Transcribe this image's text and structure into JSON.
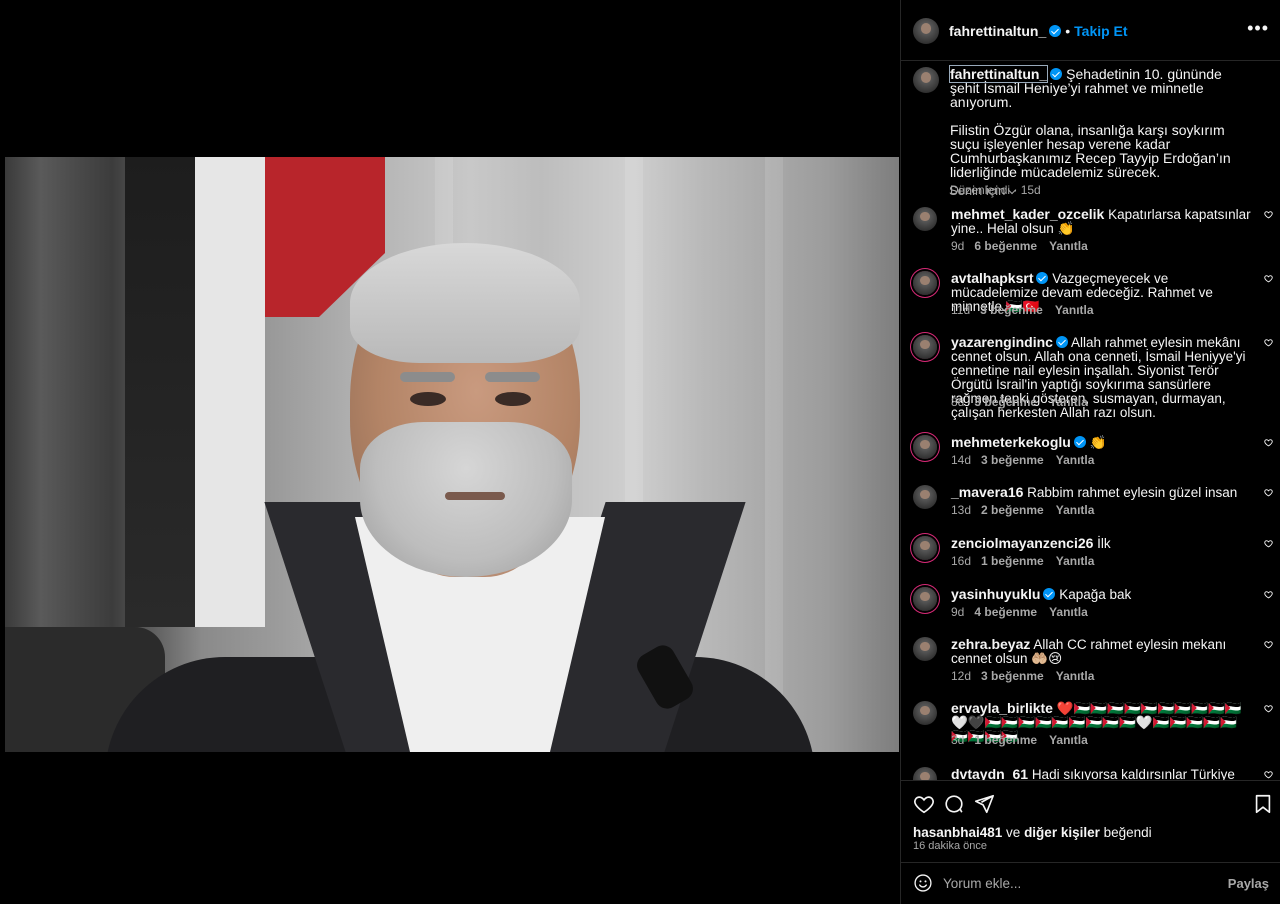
{
  "post": {
    "author": "fahrettinaltun_",
    "follow_label": "Takip Et",
    "separator": "•",
    "more_icon": "more-horizontal-icon",
    "caption_line1": "Şehadetinin 10. gününde şehit İsmail Heniye’yi rahmet ve minnetle anıyorum.",
    "caption_line2": "Filistin Özgür olana, insanlığa karşı soykırım suçu işleyenler hesap verene kadar Cumhurbaşkanımız Recep Tayyip Erdoğan’ın liderliğinde mücadelemiz sürecek.",
    "caption_meta": "Düzenlendi · 15d",
    "for_you": "Senin için"
  },
  "comments": [
    {
      "user": "mehmet_kader_ozcelik",
      "verified": false,
      "text": "Kapatırlarsa kapatsınlar yine.. Helal olsun 👏",
      "time": "9d",
      "likes": "6 beğenme",
      "reply": "Yanıtla"
    },
    {
      "user": "avtalhapksrt",
      "verified": true,
      "text": "Vazgeçmeyecek ve mücadelemize devam edeceğiz. Rahmet ve minnetle.🇵🇸🇹🇷",
      "time": "11d",
      "likes": "3 beğenme",
      "reply": "Yanıtla"
    },
    {
      "user": "yazarengindinc",
      "verified": true,
      "text": "Allah rahmet eylesin mekânı cennet olsun. Allah ona cenneti, İsmail Heniyye'yi cennetine nail eylesin inşallah. Siyonist Terör Örgütü İsrail'in yaptığı soykırıma sansürlere rağmen tepki gösteren, susmayan, durmayan, çalışan herkesten Allah razı olsun.",
      "time": "8d",
      "likes": "3 beğenme",
      "reply": "Yanıtla"
    },
    {
      "user": "mehmeterkekoglu",
      "verified": true,
      "text": "👏",
      "time": "14d",
      "likes": "3 beğenme",
      "reply": "Yanıtla"
    },
    {
      "user": "_mavera16",
      "verified": false,
      "text": "Rabbim rahmet eylesin güzel insan",
      "time": "13d",
      "likes": "2 beğenme",
      "reply": "Yanıtla"
    },
    {
      "user": "zenciolmayanzenci26",
      "verified": false,
      "text": "İlk",
      "time": "16d",
      "likes": "1 beğenme",
      "reply": "Yanıtla"
    },
    {
      "user": "yasinhuyuklu",
      "verified": true,
      "text": "Kapağa bak",
      "time": "9d",
      "likes": "4 beğenme",
      "reply": "Yanıtla"
    },
    {
      "user": "zehra.beyaz",
      "verified": false,
      "text": "Allah CC rahmet eylesin mekanı cennet olsun 🤲🏼😢",
      "time": "12d",
      "likes": "3 beğenme",
      "reply": "Yanıtla"
    },
    {
      "user": "ervayla_birlikte",
      "verified": false,
      "text": "❤️🇵🇸🇵🇸🇵🇸🇵🇸🇵🇸🇵🇸🇵🇸🇵🇸🇵🇸🇵🇸🤍🖤🇵🇸🇵🇸🇵🇸🇵🇸🇵🇸🇵🇸🇵🇸🇵🇸🇵🇸🤍🇵🇸🇵🇸🇵🇸🇵🇸🇵🇸🇵🇸🇵🇸🇵🇸🇵🇸",
      "time": "3d",
      "likes": "1 beğenme",
      "reply": "Yanıtla"
    },
    {
      "user": "dvtaydn_61",
      "verified": false,
      "text": "Hadi sıkıyorsa kaldırsınlar Türkiye cumhuriyeti",
      "time": "",
      "likes": "",
      "reply": ""
    }
  ],
  "footer": {
    "liked_by_user": "hasanbhai481",
    "liked_by_rest": " ve ",
    "liked_by_others": "diğer kişiler",
    "liked_by_suffix": " beğendi",
    "time_ago": "16 dakika önce",
    "comment_placeholder": "Yorum ekle...",
    "share_label": "Paylaş"
  },
  "colors": {
    "accent": "#0095f6",
    "background": "#000000",
    "muted": "#a8a8a8",
    "ring": "#d62976"
  }
}
